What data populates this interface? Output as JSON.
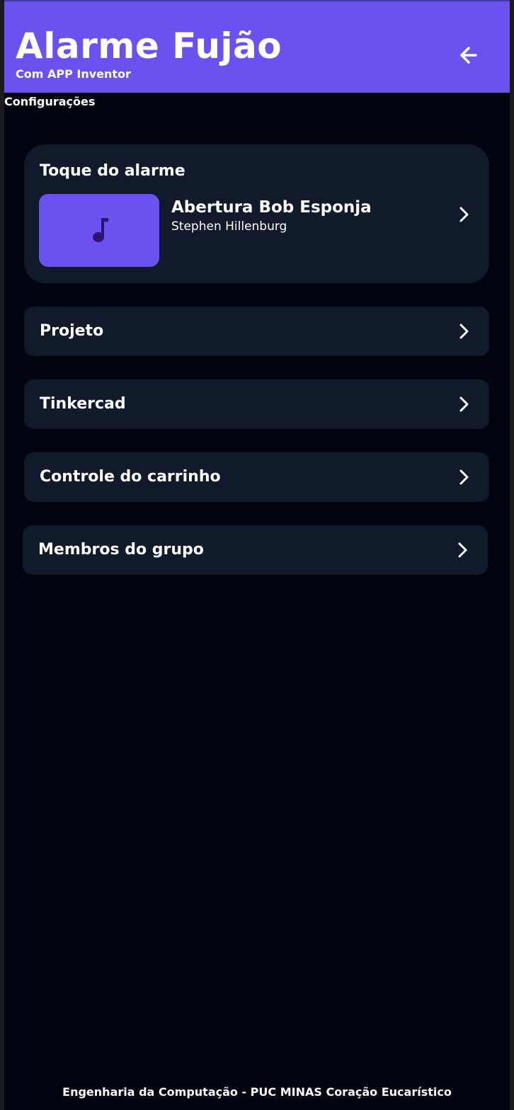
{
  "header": {
    "title": "Alarme Fujão",
    "subtitle": "Com APP Inventor",
    "back_icon": "arrow-left-icon",
    "background_color": "#6b51f0"
  },
  "section_label": "Configurações",
  "ringtone": {
    "heading": "Toque do alarme",
    "song_title": "Abertura Bob Esponja",
    "song_artist": "Stephen Hillenburg",
    "thumb_icon": "music-note-icon",
    "thumb_color": "#6b51f0"
  },
  "menu": {
    "items": [
      {
        "label": "Projeto",
        "icon": "chevron-right-icon"
      },
      {
        "label": "Tinkercad",
        "icon": "chevron-right-icon"
      },
      {
        "label": "Controle do carrinho",
        "icon": "chevron-right-icon"
      },
      {
        "label": "Membros do grupo",
        "icon": "chevron-right-icon"
      }
    ]
  },
  "footer": "Engenharia da Computação - PUC MINAS Coração Eucarístico",
  "colors": {
    "background": "#02040f",
    "card": "#111a2b",
    "accent": "#6b51f0",
    "text": "#ffffff"
  }
}
